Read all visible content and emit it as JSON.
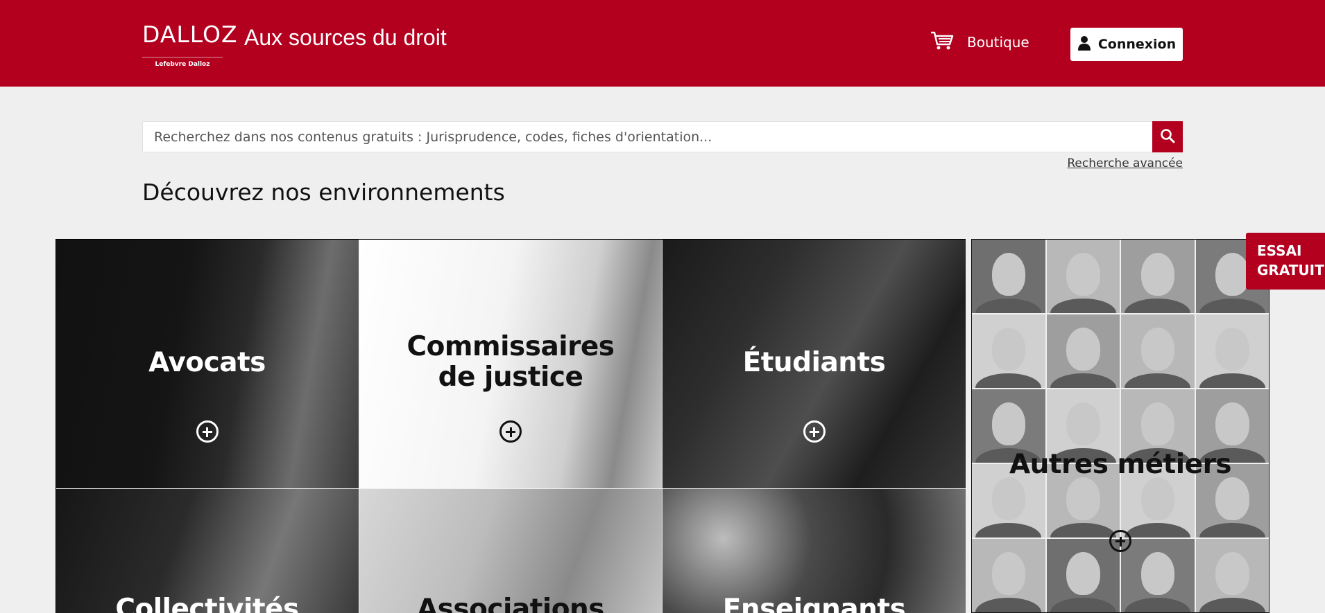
{
  "header": {
    "logo_text": "DALLOZ",
    "logo_subtitle": "Lefebvre Dalloz",
    "tagline": "Aux sources du droit",
    "boutique_label": "Boutique",
    "connexion_label": "Connexion"
  },
  "search": {
    "placeholder": "Recherchez dans nos contenus gratuits : Jurisprudence, codes, fiches d'orientation...",
    "advanced_link": "Recherche avancée"
  },
  "section_title": "Découvrez nos environnements",
  "tiles": [
    {
      "label": "Avocats"
    },
    {
      "label_line1": "Commissaires",
      "label_line2": "de justice"
    },
    {
      "label": "Étudiants"
    },
    {
      "label": "Collectivités"
    },
    {
      "label": "Associations"
    },
    {
      "label": "Enseignants"
    },
    {
      "label": "Autres métiers"
    }
  ],
  "essai": {
    "line1": "ESSAI",
    "line2": "GRATUIT"
  },
  "colors": {
    "brand_red": "#b3001f",
    "background": "#efefef"
  }
}
